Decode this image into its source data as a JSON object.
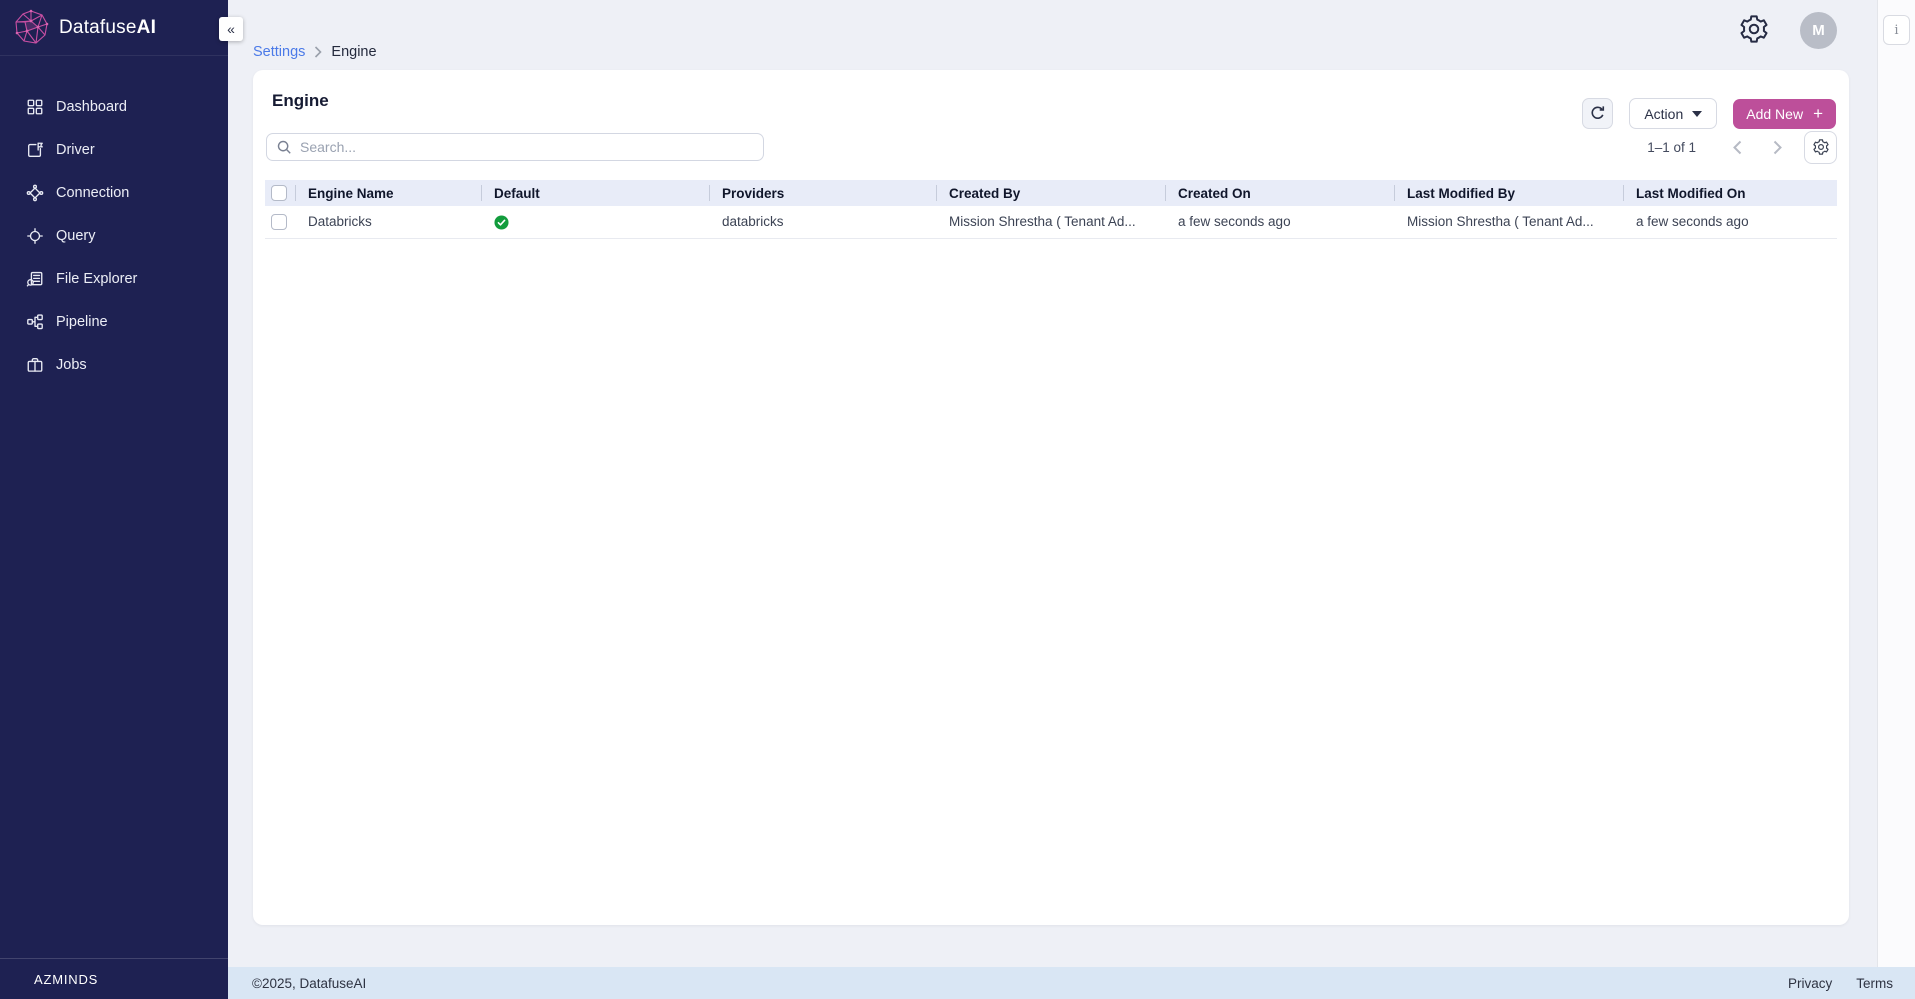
{
  "colors": {
    "sidebar_bg": "#1e2152",
    "accent_pink": "#bd4f9a",
    "link_blue": "#4b7ae8",
    "success_green": "#129c3c",
    "header_row_bg": "#e8ecf8",
    "footer_bg": "#d9e6f4"
  },
  "brand": {
    "name_part1": "Datafuse",
    "name_part2": "AI",
    "org": "AZMINDS",
    "collapse_glyph": "«"
  },
  "sidebar": {
    "items": [
      {
        "icon": "grid",
        "label": "Dashboard"
      },
      {
        "icon": "driver",
        "label": "Driver"
      },
      {
        "icon": "connection",
        "label": "Connection"
      },
      {
        "icon": "query",
        "label": "Query"
      },
      {
        "icon": "file-explorer",
        "label": "File Explorer"
      },
      {
        "icon": "pipeline",
        "label": "Pipeline"
      },
      {
        "icon": "jobs",
        "label": "Jobs"
      }
    ]
  },
  "topbar": {
    "breadcrumb_link": "Settings",
    "breadcrumb_current": "Engine",
    "avatar_initial": "M",
    "info_label": "i"
  },
  "toolbar": {
    "title": "Engine",
    "search_placeholder": "Search...",
    "action_label": "Action",
    "add_new_label": "Add New",
    "plus_glyph": "+"
  },
  "pagination": {
    "range_text": "1–1 of 1"
  },
  "table": {
    "columns": [
      "Engine Name",
      "Default",
      "Providers",
      "Created By",
      "Created On",
      "Last Modified By",
      "Last Modified On"
    ],
    "rows": [
      {
        "engine_name": "Databricks",
        "default": true,
        "providers": "databricks",
        "created_by": "Mission Shrestha ( Tenant Ad...",
        "created_on": "a few seconds ago",
        "last_modified_by": "Mission Shrestha ( Tenant Ad...",
        "last_modified_on": "a few seconds ago"
      }
    ]
  },
  "footer": {
    "copyright": "©2025, DatafuseAI",
    "links": [
      "Privacy",
      "Terms"
    ]
  }
}
